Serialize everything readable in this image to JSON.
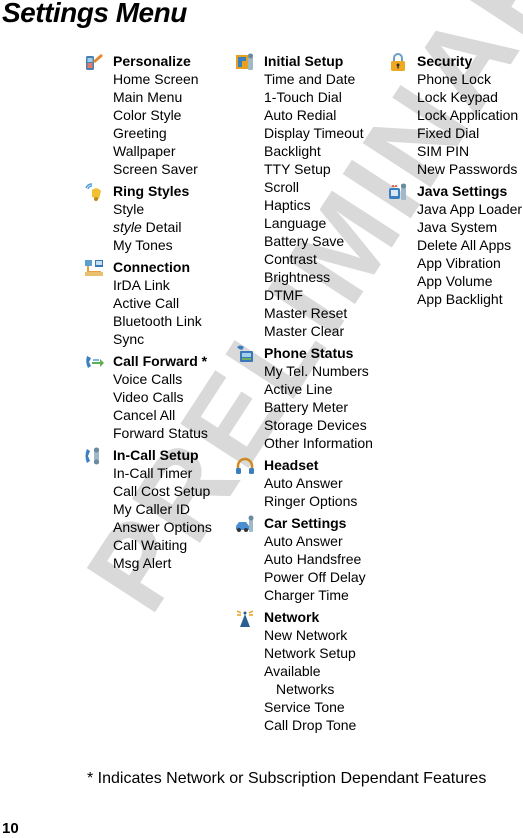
{
  "page": {
    "title": "Settings Menu",
    "watermark": "PRELIMINARY",
    "footnote": "* Indicates Network or Subscription Dependant Features",
    "page_number": "10"
  },
  "columns": [
    {
      "groups": [
        {
          "icon": "personalize-icon",
          "heading": "Personalize",
          "items": [
            "Home Screen",
            "Main Menu",
            "Color Style",
            "Greeting",
            "Wallpaper",
            "Screen Saver"
          ]
        },
        {
          "icon": "ring-styles-icon",
          "heading": "Ring Styles",
          "items": [
            "Style",
            "style Detail",
            "My Tones"
          ]
        },
        {
          "icon": "connection-icon",
          "heading": "Connection",
          "items": [
            "IrDA Link",
            "Active Call",
            "Bluetooth Link",
            "Sync"
          ]
        },
        {
          "icon": "call-forward-icon",
          "heading": "Call Forward *",
          "items": [
            "Voice Calls",
            "Video Calls",
            "Cancel All",
            "Forward Status"
          ]
        },
        {
          "icon": "in-call-setup-icon",
          "heading": "In-Call Setup",
          "items": [
            "In-Call Timer",
            "Call Cost Setup",
            "My Caller ID",
            "Answer Options",
            "Call Waiting",
            "Msg Alert"
          ]
        }
      ]
    },
    {
      "groups": [
        {
          "icon": "initial-setup-icon",
          "heading": "Initial Setup",
          "items": [
            "Time and Date",
            "1-Touch Dial",
            "Auto Redial",
            "Display Timeout",
            "Backlight",
            "TTY Setup",
            "Scroll",
            "Haptics",
            "Language",
            "Battery Save",
            "Contrast",
            "Brightness",
            "DTMF",
            "Master Reset",
            "Master Clear"
          ]
        },
        {
          "icon": "phone-status-icon",
          "heading": "Phone Status",
          "items": [
            "My Tel. Numbers",
            "Active Line",
            "Battery Meter",
            "Storage Devices",
            "Other Information"
          ]
        },
        {
          "icon": "headset-icon",
          "heading": "Headset",
          "items": [
            "Auto Answer",
            "Ringer Options"
          ]
        },
        {
          "icon": "car-settings-icon",
          "heading": "Car Settings",
          "items": [
            "Auto Answer",
            "Auto Handsfree",
            "Power Off Delay",
            "Charger Time"
          ]
        },
        {
          "icon": "network-icon",
          "heading": "Network",
          "items": [
            "New Network",
            "Network Setup",
            "Available Networks",
            "Service Tone",
            "Call Drop Tone"
          ]
        }
      ]
    },
    {
      "groups": [
        {
          "icon": "security-icon",
          "heading": "Security",
          "items": [
            "Phone Lock",
            "Lock Keypad",
            "Lock Application",
            "Fixed Dial",
            "SIM PIN",
            "New Passwords"
          ]
        },
        {
          "icon": "java-settings-icon",
          "heading": "Java Settings",
          "items": [
            "Java App Loader",
            "Java System",
            "Delete All Apps",
            "App Vibration",
            "App Volume",
            "App Backlight"
          ]
        }
      ]
    }
  ]
}
